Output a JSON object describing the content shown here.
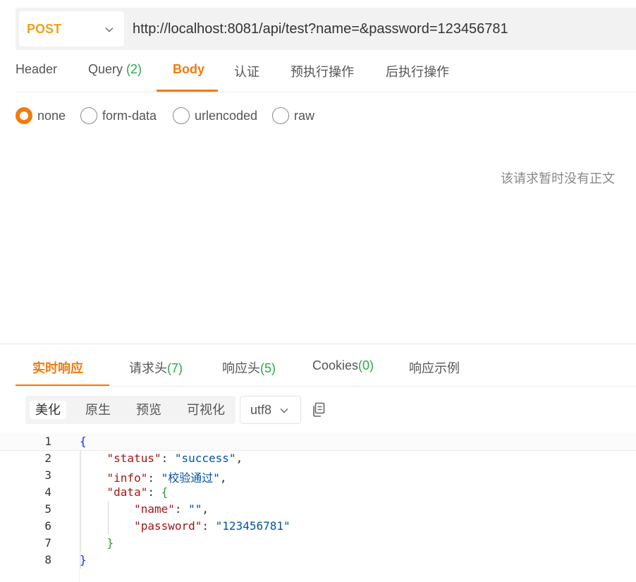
{
  "request": {
    "method": "POST",
    "url": "http://localhost:8081/api/test?name=&password=123456781"
  },
  "request_tabs": [
    {
      "label": "Header",
      "count": ""
    },
    {
      "label": "Query ",
      "count": "(2)"
    },
    {
      "label": "Body",
      "count": "",
      "active": true
    },
    {
      "label": "认证",
      "count": ""
    },
    {
      "label": "预执行操作",
      "count": ""
    },
    {
      "label": "后执行操作",
      "count": ""
    }
  ],
  "body_types": [
    {
      "label": "none",
      "checked": true
    },
    {
      "label": "form-data",
      "checked": false
    },
    {
      "label": "urlencoded",
      "checked": false
    },
    {
      "label": "raw",
      "checked": false
    }
  ],
  "empty_body_text": "该请求暂时没有正文",
  "response_tabs": [
    {
      "label": "实时响应",
      "count": "",
      "active": true
    },
    {
      "label": "请求头",
      "count": "(7)"
    },
    {
      "label": "响应头",
      "count": "(5)"
    },
    {
      "label": "Cookies",
      "count": "(0)"
    },
    {
      "label": "响应示例",
      "count": ""
    }
  ],
  "view_modes": [
    "美化",
    "原生",
    "预览",
    "可视化"
  ],
  "active_view_mode": "美化",
  "encoding": "utf8",
  "icons": {
    "method_dropdown": "chevron-down-icon",
    "encoding_dropdown": "chevron-down-icon",
    "copy": "copy-icon"
  },
  "colors": {
    "accent": "#f47a0e",
    "method": "#f0a020",
    "count": "#2aa84a"
  },
  "response_json": {
    "line_numbers": [
      "1",
      "2",
      "3",
      "4",
      "5",
      "6",
      "7",
      "8"
    ],
    "open_brace": "{",
    "close_brace": "}",
    "status_key": "\"status\"",
    "status_value": "\"success\"",
    "info_key": "\"info\"",
    "info_value": "\"校验通过\"",
    "data_key": "\"data\"",
    "data_open": "{",
    "data_close": "}",
    "name_key": "\"name\"",
    "name_value": "\"\"",
    "password_key": "\"password\"",
    "password_value": "\"123456781\""
  }
}
